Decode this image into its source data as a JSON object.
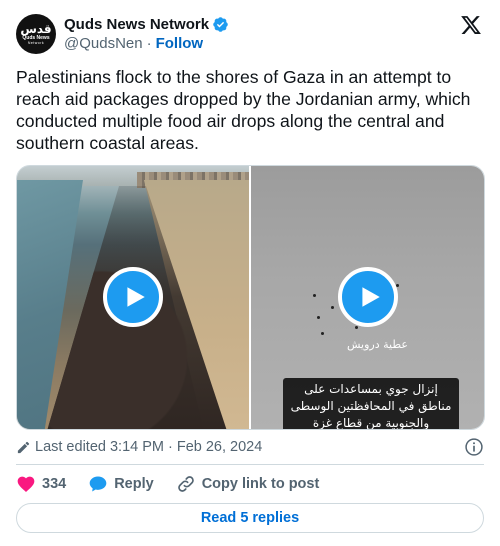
{
  "author": {
    "avatar_text_arabic": "قدس",
    "avatar_text_latin": "Quds News",
    "avatar_text_small": "Network",
    "name": "Quds News Network",
    "handle": "@QudsNen",
    "separator": "·",
    "follow_label": "Follow"
  },
  "tweet": {
    "text": "Palestinians flock to the shores of Gaza in an attempt to reach aid packages dropped by the Jordanian army, which conducted multiple food air drops along the central and southern coastal areas."
  },
  "media": {
    "right_watermark": "عطية درويش",
    "right_caption": "إنزال جوي بمساعدات على مناطق في المحافظتين الوسطى والجنوبية من قطاع غزة"
  },
  "meta": {
    "edited_label": "Last edited 3:14 PM · Feb 26, 2024"
  },
  "actions": {
    "like_count": "334",
    "reply_label": "Reply",
    "copy_label": "Copy link to post"
  },
  "replies_button": "Read 5 replies",
  "colors": {
    "accent": "#1d9bf0",
    "link": "#006fd6",
    "like": "#f91880",
    "muted": "#536471"
  },
  "icons": [
    "verified-badge-icon",
    "x-logo-icon",
    "play-icon",
    "pencil-icon",
    "info-icon",
    "heart-icon",
    "speech-bubble-icon",
    "link-icon"
  ]
}
